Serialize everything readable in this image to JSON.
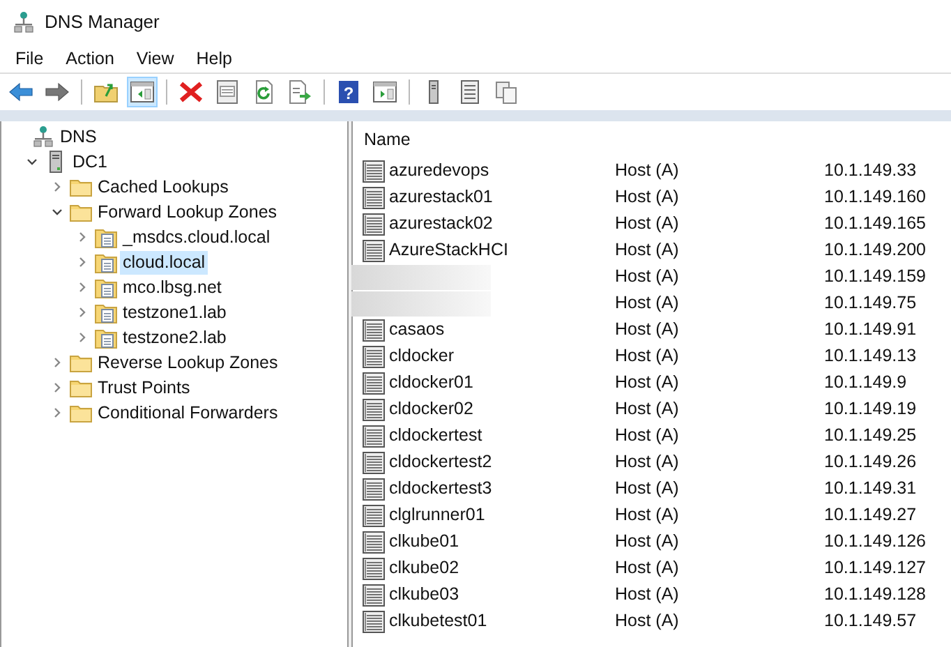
{
  "window": {
    "title": "DNS Manager"
  },
  "menu": [
    "File",
    "Action",
    "View",
    "Help"
  ],
  "toolbar": [
    {
      "kind": "back",
      "pressed": false
    },
    {
      "kind": "forward",
      "pressed": false
    },
    {
      "kind": "sep"
    },
    {
      "kind": "up",
      "pressed": false
    },
    {
      "kind": "tree",
      "pressed": true
    },
    {
      "kind": "sep"
    },
    {
      "kind": "delete",
      "pressed": false
    },
    {
      "kind": "properties",
      "pressed": false
    },
    {
      "kind": "refresh",
      "pressed": false
    },
    {
      "kind": "export",
      "pressed": false
    },
    {
      "kind": "sep"
    },
    {
      "kind": "help",
      "pressed": false,
      "glyph": "?"
    },
    {
      "kind": "action",
      "pressed": false
    },
    {
      "kind": "sep"
    },
    {
      "kind": "server",
      "pressed": false
    },
    {
      "kind": "list",
      "pressed": false
    },
    {
      "kind": "copy",
      "pressed": false
    }
  ],
  "tree": [
    {
      "label": "DNS",
      "kind": "dns",
      "selected": false,
      "children": [
        {
          "label": "DC1",
          "kind": "server",
          "expanded": true,
          "selected": false,
          "children": [
            {
              "label": "Cached Lookups",
              "kind": "folder",
              "expanded": false,
              "selected": false
            },
            {
              "label": "Forward Lookup Zones",
              "kind": "folder",
              "expanded": true,
              "selected": false,
              "children": [
                {
                  "label": "_msdcs.cloud.local",
                  "kind": "zone",
                  "expanded": false,
                  "selected": false
                },
                {
                  "label": "cloud.local",
                  "kind": "zone",
                  "expanded": false,
                  "selected": true
                },
                {
                  "label": "mco.lbsg.net",
                  "kind": "zone",
                  "expanded": false,
                  "selected": false
                },
                {
                  "label": "testzone1.lab",
                  "kind": "zone",
                  "expanded": false,
                  "selected": false
                },
                {
                  "label": "testzone2.lab",
                  "kind": "zone",
                  "expanded": false,
                  "selected": false
                }
              ]
            },
            {
              "label": "Reverse Lookup Zones",
              "kind": "folder",
              "expanded": false,
              "selected": false
            },
            {
              "label": "Trust Points",
              "kind": "folder",
              "expanded": false,
              "selected": false
            },
            {
              "label": "Conditional Forwarders",
              "kind": "folder",
              "expanded": false,
              "selected": false
            }
          ]
        }
      ]
    }
  ],
  "table": {
    "columns": [
      "Name"
    ],
    "rows": [
      {
        "name": "azuredevops",
        "type": "Host (A)",
        "data": "10.1.149.33"
      },
      {
        "name": "azurestack01",
        "type": "Host (A)",
        "data": "10.1.149.160"
      },
      {
        "name": "azurestack02",
        "type": "Host (A)",
        "data": "10.1.149.165"
      },
      {
        "name": "AzureStackHCI",
        "type": "Host (A)",
        "data": "10.1.149.200"
      },
      {
        "redacted": true,
        "type": "Host (A)",
        "data": "10.1.149.159"
      },
      {
        "redacted": true,
        "type": "Host (A)",
        "data": "10.1.149.75"
      },
      {
        "name": "casaos",
        "type": "Host (A)",
        "data": "10.1.149.91"
      },
      {
        "name": "cldocker",
        "type": "Host (A)",
        "data": "10.1.149.13"
      },
      {
        "name": "cldocker01",
        "type": "Host (A)",
        "data": "10.1.149.9"
      },
      {
        "name": "cldocker02",
        "type": "Host (A)",
        "data": "10.1.149.19"
      },
      {
        "name": "cldockertest",
        "type": "Host (A)",
        "data": "10.1.149.25"
      },
      {
        "name": "cldockertest2",
        "type": "Host (A)",
        "data": "10.1.149.26"
      },
      {
        "name": "cldockertest3",
        "type": "Host (A)",
        "data": "10.1.149.31"
      },
      {
        "name": "clglrunner01",
        "type": "Host (A)",
        "data": "10.1.149.27"
      },
      {
        "name": "clkube01",
        "type": "Host (A)",
        "data": "10.1.149.126"
      },
      {
        "name": "clkube02",
        "type": "Host (A)",
        "data": "10.1.149.127"
      },
      {
        "name": "clkube03",
        "type": "Host (A)",
        "data": "10.1.149.128"
      },
      {
        "name": "clkubetest01",
        "type": "Host (A)",
        "data": "10.1.149.57"
      }
    ]
  }
}
